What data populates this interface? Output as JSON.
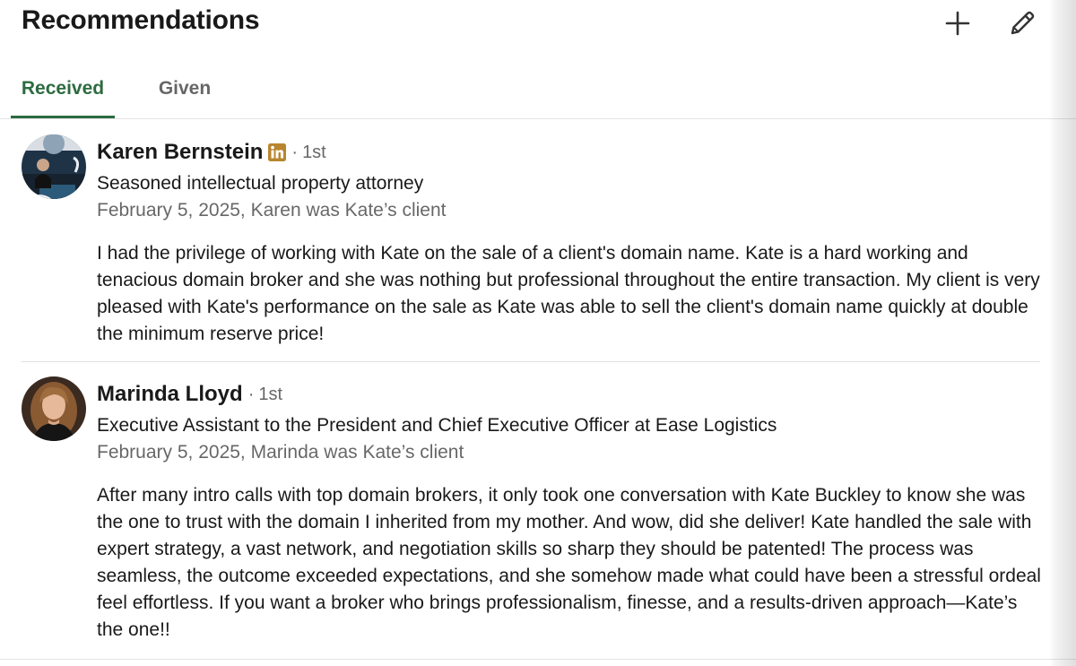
{
  "header": {
    "title": "Recommendations",
    "add_icon": "plus-icon",
    "edit_icon": "pencil-icon"
  },
  "tabs": [
    {
      "label": "Received",
      "active": true
    },
    {
      "label": "Given",
      "active": false
    }
  ],
  "recommendations": [
    {
      "name": "Karen Bernstein",
      "badge_icon": "linkedin-premium-icon",
      "separator": "·",
      "degree": "1st",
      "headline": "Seasoned intellectual property attorney",
      "meta": "February 5, 2025, Karen was Kate’s client",
      "text": "I had the privilege of working with Kate on the sale of a client's domain name. Kate is a hard working and tenacious domain broker and she was nothing but professional throughout the entire transaction. My client is very pleased with Kate's performance on the sale as Kate was able to sell the client's domain name quickly at double the minimum reserve price!"
    },
    {
      "name": "Marinda Lloyd",
      "separator": "·",
      "degree": "1st",
      "headline": "Executive Assistant to the President and Chief Executive Officer at Ease Logistics",
      "meta": "February 5, 2025, Marinda was Kate’s client",
      "text": "After many intro calls with top domain brokers, it only took one conversation with Kate Buckley to know she was the one to trust with the domain I inherited from my mother. And wow, did she deliver! Kate handled the sale with expert strategy, a vast network, and negotiation skills so sharp they should be patented! The process was seamless, the outcome exceeded expectations, and she somehow made what could have been a stressful ordeal feel effortless. If you want a broker who brings professionalism, finesse, and a results-driven approach—Kate’s the one!!"
    }
  ],
  "colors": {
    "active_tab": "#2d6b40",
    "premium_badge": "#b8862e",
    "secondary_text": "#666666"
  }
}
